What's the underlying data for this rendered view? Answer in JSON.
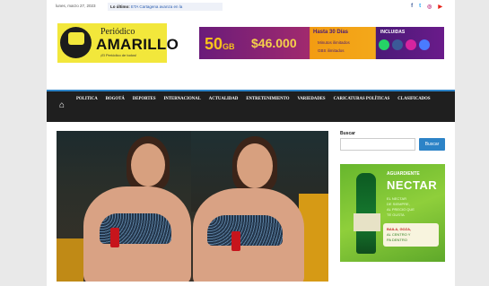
{
  "topbar": {
    "date": "lunes, marzo 27, 2023",
    "ticker_label": "Lo último:",
    "ticker_text": "ETA Cartagena avanza en la",
    "social_icons": [
      "facebook-icon",
      "twitter-icon",
      "instagram-icon",
      "youtube-icon"
    ]
  },
  "logo": {
    "top": "Periódico",
    "main": "AMARILLO",
    "sub": "¡El Periódico de todos!"
  },
  "ad_banner": {
    "gb": "50",
    "gb_unit": "GB",
    "price": "$46.000",
    "hasta": "Hasta 30 Días",
    "minutes": "Minutos ilimitados",
    "gbs": "GBS ilimitados",
    "incluidas": "INCLUIDAS"
  },
  "nav": {
    "items": [
      "POLITICA",
      "BOGOTÁ",
      "DEPORTES",
      "INTERNACIONAL",
      "ACTUALIDAD",
      "ENTRETENIMIENTO",
      "VARIEDADES",
      "CARICATURAS POLÍTICAS",
      "CLASIFICADOS"
    ]
  },
  "sidebar": {
    "search_label": "Buscar",
    "search_button": "Buscar",
    "search_placeholder": ""
  },
  "ad_side": {
    "brand": "AGUARDIENTE",
    "title": "NECTAR",
    "line1": "EL NECTAR",
    "line2": "DE SIEMPRE,",
    "line3": "AL PRECIO QUE",
    "line4": "TE GUSTA",
    "line5": "BAILA, GOZA,",
    "line6": "AL CENTRO Y",
    "line7": "PA DENTRO"
  },
  "colors": {
    "accent": "#2c83c7",
    "nav_bg": "#1f1f1f",
    "logo_yellow": "#f2e73b"
  }
}
